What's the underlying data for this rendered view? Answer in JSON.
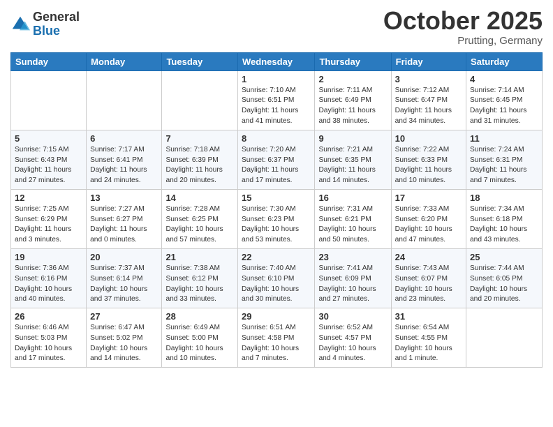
{
  "header": {
    "logo_general": "General",
    "logo_blue": "Blue",
    "month": "October 2025",
    "location": "Prutting, Germany"
  },
  "days_of_week": [
    "Sunday",
    "Monday",
    "Tuesday",
    "Wednesday",
    "Thursday",
    "Friday",
    "Saturday"
  ],
  "weeks": [
    {
      "days": [
        {
          "num": "",
          "info": ""
        },
        {
          "num": "",
          "info": ""
        },
        {
          "num": "",
          "info": ""
        },
        {
          "num": "1",
          "info": "Sunrise: 7:10 AM\nSunset: 6:51 PM\nDaylight: 11 hours\nand 41 minutes."
        },
        {
          "num": "2",
          "info": "Sunrise: 7:11 AM\nSunset: 6:49 PM\nDaylight: 11 hours\nand 38 minutes."
        },
        {
          "num": "3",
          "info": "Sunrise: 7:12 AM\nSunset: 6:47 PM\nDaylight: 11 hours\nand 34 minutes."
        },
        {
          "num": "4",
          "info": "Sunrise: 7:14 AM\nSunset: 6:45 PM\nDaylight: 11 hours\nand 31 minutes."
        }
      ]
    },
    {
      "days": [
        {
          "num": "5",
          "info": "Sunrise: 7:15 AM\nSunset: 6:43 PM\nDaylight: 11 hours\nand 27 minutes."
        },
        {
          "num": "6",
          "info": "Sunrise: 7:17 AM\nSunset: 6:41 PM\nDaylight: 11 hours\nand 24 minutes."
        },
        {
          "num": "7",
          "info": "Sunrise: 7:18 AM\nSunset: 6:39 PM\nDaylight: 11 hours\nand 20 minutes."
        },
        {
          "num": "8",
          "info": "Sunrise: 7:20 AM\nSunset: 6:37 PM\nDaylight: 11 hours\nand 17 minutes."
        },
        {
          "num": "9",
          "info": "Sunrise: 7:21 AM\nSunset: 6:35 PM\nDaylight: 11 hours\nand 14 minutes."
        },
        {
          "num": "10",
          "info": "Sunrise: 7:22 AM\nSunset: 6:33 PM\nDaylight: 11 hours\nand 10 minutes."
        },
        {
          "num": "11",
          "info": "Sunrise: 7:24 AM\nSunset: 6:31 PM\nDaylight: 11 hours\nand 7 minutes."
        }
      ]
    },
    {
      "days": [
        {
          "num": "12",
          "info": "Sunrise: 7:25 AM\nSunset: 6:29 PM\nDaylight: 11 hours\nand 3 minutes."
        },
        {
          "num": "13",
          "info": "Sunrise: 7:27 AM\nSunset: 6:27 PM\nDaylight: 11 hours\nand 0 minutes."
        },
        {
          "num": "14",
          "info": "Sunrise: 7:28 AM\nSunset: 6:25 PM\nDaylight: 10 hours\nand 57 minutes."
        },
        {
          "num": "15",
          "info": "Sunrise: 7:30 AM\nSunset: 6:23 PM\nDaylight: 10 hours\nand 53 minutes."
        },
        {
          "num": "16",
          "info": "Sunrise: 7:31 AM\nSunset: 6:21 PM\nDaylight: 10 hours\nand 50 minutes."
        },
        {
          "num": "17",
          "info": "Sunrise: 7:33 AM\nSunset: 6:20 PM\nDaylight: 10 hours\nand 47 minutes."
        },
        {
          "num": "18",
          "info": "Sunrise: 7:34 AM\nSunset: 6:18 PM\nDaylight: 10 hours\nand 43 minutes."
        }
      ]
    },
    {
      "days": [
        {
          "num": "19",
          "info": "Sunrise: 7:36 AM\nSunset: 6:16 PM\nDaylight: 10 hours\nand 40 minutes."
        },
        {
          "num": "20",
          "info": "Sunrise: 7:37 AM\nSunset: 6:14 PM\nDaylight: 10 hours\nand 37 minutes."
        },
        {
          "num": "21",
          "info": "Sunrise: 7:38 AM\nSunset: 6:12 PM\nDaylight: 10 hours\nand 33 minutes."
        },
        {
          "num": "22",
          "info": "Sunrise: 7:40 AM\nSunset: 6:10 PM\nDaylight: 10 hours\nand 30 minutes."
        },
        {
          "num": "23",
          "info": "Sunrise: 7:41 AM\nSunset: 6:09 PM\nDaylight: 10 hours\nand 27 minutes."
        },
        {
          "num": "24",
          "info": "Sunrise: 7:43 AM\nSunset: 6:07 PM\nDaylight: 10 hours\nand 23 minutes."
        },
        {
          "num": "25",
          "info": "Sunrise: 7:44 AM\nSunset: 6:05 PM\nDaylight: 10 hours\nand 20 minutes."
        }
      ]
    },
    {
      "days": [
        {
          "num": "26",
          "info": "Sunrise: 6:46 AM\nSunset: 5:03 PM\nDaylight: 10 hours\nand 17 minutes."
        },
        {
          "num": "27",
          "info": "Sunrise: 6:47 AM\nSunset: 5:02 PM\nDaylight: 10 hours\nand 14 minutes."
        },
        {
          "num": "28",
          "info": "Sunrise: 6:49 AM\nSunset: 5:00 PM\nDaylight: 10 hours\nand 10 minutes."
        },
        {
          "num": "29",
          "info": "Sunrise: 6:51 AM\nSunset: 4:58 PM\nDaylight: 10 hours\nand 7 minutes."
        },
        {
          "num": "30",
          "info": "Sunrise: 6:52 AM\nSunset: 4:57 PM\nDaylight: 10 hours\nand 4 minutes."
        },
        {
          "num": "31",
          "info": "Sunrise: 6:54 AM\nSunset: 4:55 PM\nDaylight: 10 hours\nand 1 minute."
        },
        {
          "num": "",
          "info": ""
        }
      ]
    }
  ]
}
